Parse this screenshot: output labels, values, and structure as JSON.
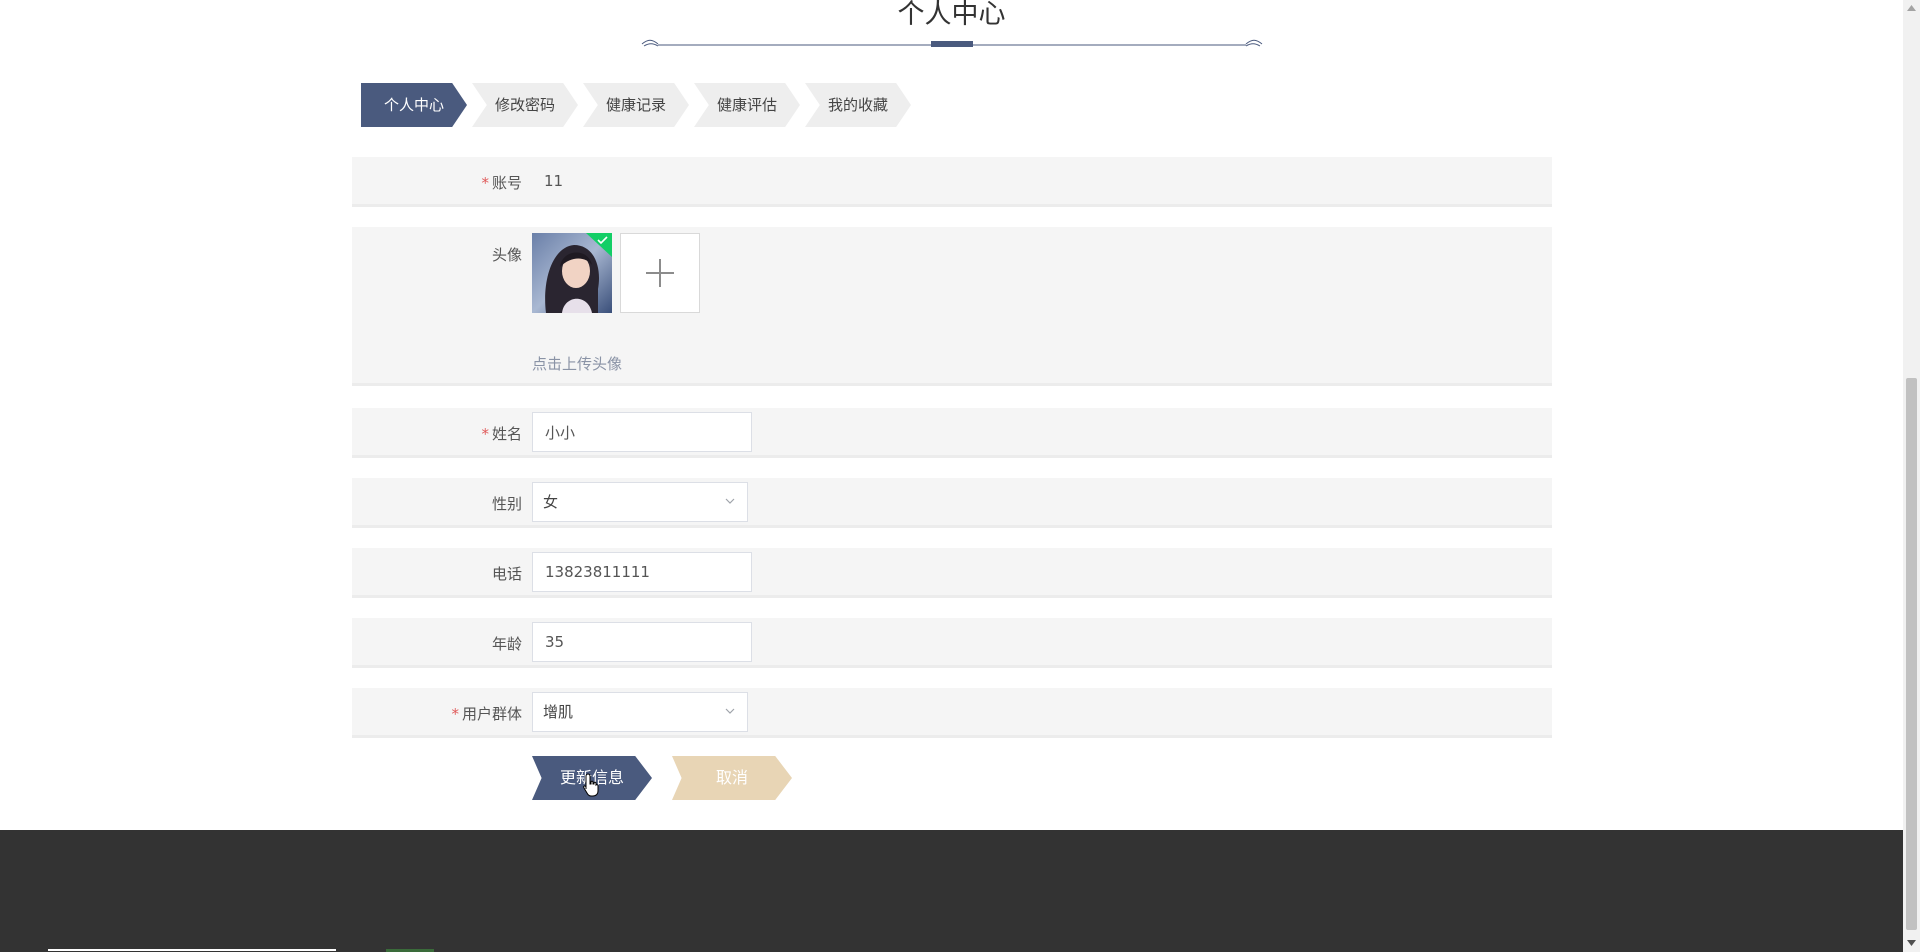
{
  "page": {
    "title": "个人中心"
  },
  "tabs": [
    {
      "label": "个人中心",
      "active": true
    },
    {
      "label": "修改密码",
      "active": false
    },
    {
      "label": "健康记录",
      "active": false
    },
    {
      "label": "健康评估",
      "active": false
    },
    {
      "label": "我的收藏",
      "active": false
    }
  ],
  "form": {
    "required_mark": "*",
    "account": {
      "label": "账号",
      "value": "11"
    },
    "avatar": {
      "label": "头像",
      "upload_hint": "点击上传头像",
      "upload_icon": "plus-icon",
      "status_icon": "check-icon"
    },
    "name": {
      "label": "姓名",
      "value": "小小"
    },
    "gender": {
      "label": "性别",
      "value": "女"
    },
    "phone": {
      "label": "电话",
      "value": "13823811111"
    },
    "age": {
      "label": "年龄",
      "value": "35"
    },
    "group": {
      "label": "用户群体",
      "value": "增肌"
    }
  },
  "buttons": {
    "update_label": "更新信息",
    "cancel_label": "取消"
  },
  "colors": {
    "accent": "#4a5a7e",
    "cancel": "#e8d5b5",
    "success": "#13ce66",
    "required": "#e05a5a",
    "footer": "#333333"
  }
}
